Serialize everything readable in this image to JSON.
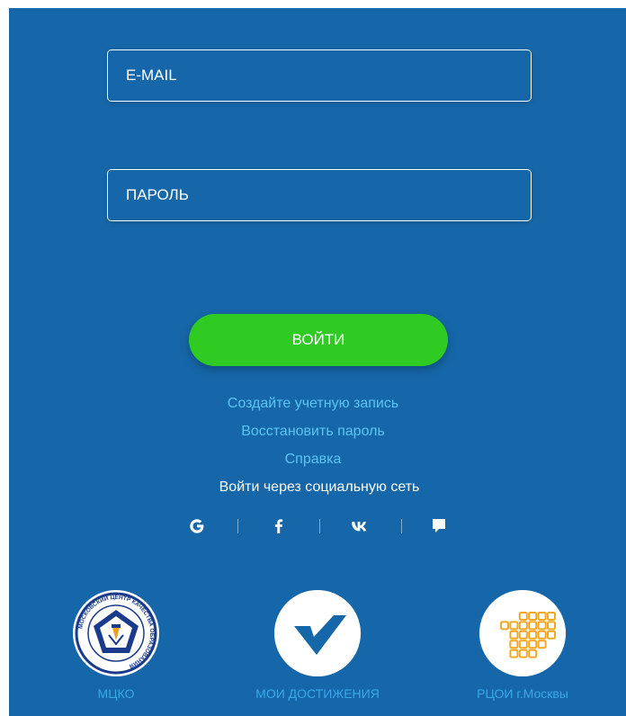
{
  "form": {
    "email_placeholder": "E-MAIL",
    "password_placeholder": "ПАРОЛЬ",
    "login_label": "ВОЙТИ"
  },
  "links": {
    "create_account": "Создайте учетную запись",
    "restore_password": "Восстановить пароль",
    "help": "Справка"
  },
  "social": {
    "label": "Войти через социальную сеть",
    "providers": [
      "google-icon",
      "facebook-icon",
      "vk-icon",
      "chat-icon"
    ]
  },
  "orgs": [
    {
      "label": "МЦКО",
      "logo_text": "МОСКОВСКИЙ ЦЕНТР КАЧЕСТВА ОБРАЗОВАНИЯ"
    },
    {
      "label": "МОИ ДОСТИЖЕНИЯ"
    },
    {
      "label": "РЦОИ г.Москвы"
    }
  ],
  "colors": {
    "panel": "#1667a9",
    "button": "#2fcb22",
    "link": "#5cc4f5",
    "org_label": "#3aa8e8",
    "rcoi_orange": "#f5a623"
  }
}
